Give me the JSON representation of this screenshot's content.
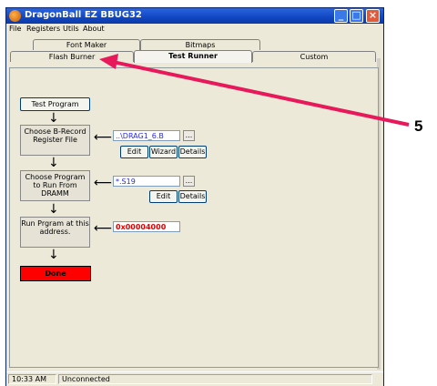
{
  "window": {
    "title": "DragonBall EZ BBUG32",
    "controls": {
      "minimize": "",
      "maximize": "",
      "close": "×"
    }
  },
  "menu": [
    "File",
    "Registers",
    "Utils",
    "About"
  ],
  "tabs_back": [
    "Font Maker",
    "Bitmaps"
  ],
  "tabs_front": [
    "Flash Burner",
    "Test Runner",
    "Custom"
  ],
  "active_tab": "Test Runner",
  "steps": {
    "test_program": "Test Program",
    "choose_srec": "Choose B-Record Register File",
    "srec_path": "..\\DRAG1_6.B",
    "browse": "...",
    "edit": "Edit",
    "wizard": "Wizard",
    "details": "Details",
    "choose_program": "Choose Program to Run From DRAMM",
    "program_path": "*.S19",
    "run_program": "Run Prgram at this address.",
    "address": "0x00004000",
    "done": "Done"
  },
  "status": {
    "time": "10:33 AM",
    "connection": "Unconnected"
  },
  "callout": {
    "number": "5",
    "color": "#e8195a"
  },
  "colors": {
    "titlebar": "#1146c2",
    "done": "#ff0000",
    "address_text": "#e00000",
    "path_text": "#2b2bdf"
  }
}
